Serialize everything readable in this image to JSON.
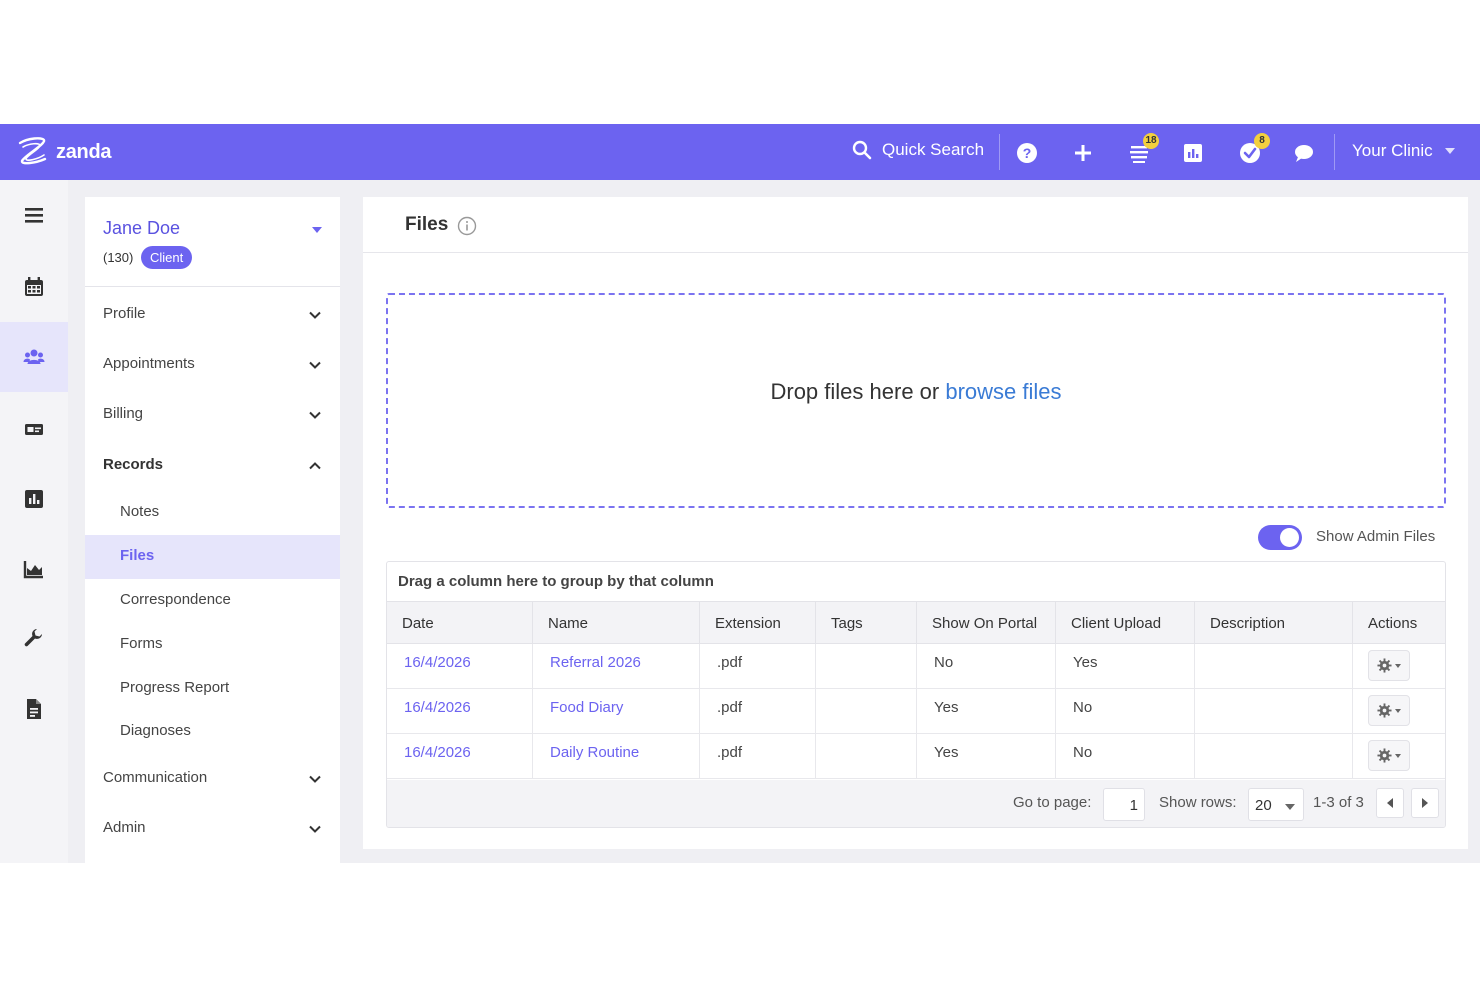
{
  "brand": {
    "name": "zanda"
  },
  "topbar": {
    "search_label": "Quick Search",
    "icons": [
      "help-icon",
      "plus-icon",
      "tasks-list-icon",
      "reports-icon",
      "checklist-icon",
      "chat-icon"
    ],
    "tasks_badge": "18",
    "checklist_badge": "8",
    "clinic_label": "Your Clinic"
  },
  "rail": {
    "items": [
      "menu-icon",
      "calendar-icon",
      "clients-icon",
      "billing-icon",
      "reports-icon",
      "chart-icon",
      "wrench-icon",
      "document-icon"
    ],
    "active": "clients-icon"
  },
  "client": {
    "name": "Jane Doe",
    "id": "(130)",
    "badge": "Client"
  },
  "nav": {
    "profile": "Profile",
    "appointments": "Appointments",
    "billing": "Billing",
    "records": "Records",
    "records_sub": {
      "notes": "Notes",
      "files": "Files",
      "correspondence": "Correspondence",
      "forms": "Forms",
      "progress_report": "Progress Report",
      "diagnoses": "Diagnoses"
    },
    "communication": "Communication",
    "admin": "Admin"
  },
  "files": {
    "title": "Files",
    "dropzone_text": "Drop files here or ",
    "dropzone_link": "browse files",
    "toggle_label": "Show Admin Files",
    "toggle_on": true
  },
  "grid": {
    "group_hint": "Drag a column here to group by that column",
    "columns": {
      "date": "Date",
      "name": "Name",
      "extension": "Extension",
      "tags": "Tags",
      "show_on_portal": "Show On Portal",
      "client_upload": "Client Upload",
      "description": "Description",
      "actions": "Actions"
    },
    "rows": [
      {
        "date": "16/4/2026",
        "name": "Referral 2026",
        "extension": ".pdf",
        "tags": "",
        "show_on_portal": "No",
        "client_upload": "Yes",
        "description": ""
      },
      {
        "date": "16/4/2026",
        "name": "Food Diary",
        "extension": ".pdf",
        "tags": "",
        "show_on_portal": "Yes",
        "client_upload": "No",
        "description": ""
      },
      {
        "date": "16/4/2026",
        "name": "Daily Routine",
        "extension": ".pdf",
        "tags": "",
        "show_on_portal": "Yes",
        "client_upload": "No",
        "description": ""
      }
    ],
    "footer": {
      "goto_label": "Go to page:",
      "goto_value": "1",
      "rows_label": "Show rows:",
      "rows_value": "20",
      "range": "1-3 of 3"
    }
  },
  "colors": {
    "accent": "#6c63f0",
    "link": "#3a7bd5",
    "badge": "#f3d03e"
  }
}
